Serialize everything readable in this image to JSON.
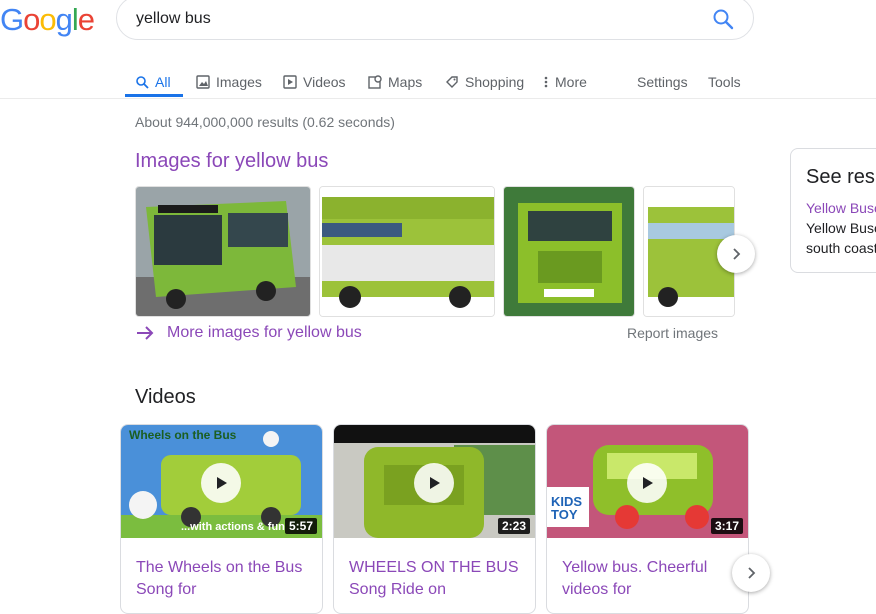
{
  "logo": {
    "letters": [
      "G",
      "o",
      "o",
      "g",
      "l",
      "e"
    ],
    "colors": [
      "#4285f4",
      "#ea4335",
      "#fbbc05",
      "#4285f4",
      "#34a853",
      "#ea4335"
    ]
  },
  "search": {
    "query": "yellow bus",
    "icon": "search-icon"
  },
  "tabs": [
    {
      "label": "All",
      "icon": "search-icon",
      "active": true
    },
    {
      "label": "Images",
      "icon": "image-icon"
    },
    {
      "label": "Videos",
      "icon": "play-square-icon"
    },
    {
      "label": "Maps",
      "icon": "map-pin-icon"
    },
    {
      "label": "Shopping",
      "icon": "tag-icon"
    },
    {
      "label": "More",
      "icon": "more-vert-icon"
    }
  ],
  "tools": {
    "settings": "Settings",
    "tools": "Tools"
  },
  "stats": "About 944,000,000 results (0.62 seconds)",
  "images_section": {
    "heading": "Images for yellow bus",
    "more_link": "More images for yellow bus",
    "report": "Report images"
  },
  "side_panel": {
    "title": "See res",
    "link": "Yellow Buse",
    "lines": [
      "Yellow Buse",
      "south coast"
    ]
  },
  "videos_section": {
    "heading": "Videos",
    "items": [
      {
        "title": "The Wheels on the Bus Song for",
        "duration": "5:57",
        "overlay_top": "Wheels on the Bus",
        "overlay_bottom": "...with actions & fun"
      },
      {
        "title": "WHEELS ON THE BUS Song Ride on",
        "duration": "2:23"
      },
      {
        "title": "Yellow bus. Cheerful videos for",
        "duration": "3:17",
        "overlay_logo_line1": "KIDS",
        "overlay_logo_line2": "TOY"
      }
    ]
  },
  "colors": {
    "link": "#8b48b8",
    "accent": "#1a73e8",
    "muted": "#70757a"
  }
}
